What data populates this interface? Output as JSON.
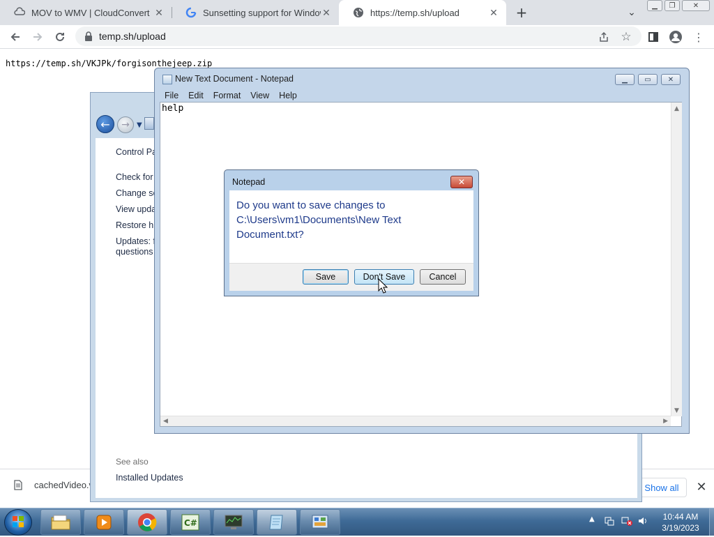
{
  "browser": {
    "tabs": [
      {
        "title": "MOV to WMV | CloudConvert",
        "icon": "cloudconvert-icon",
        "active": false
      },
      {
        "title": "Sunsetting support for Windows",
        "icon": "google-icon",
        "active": false
      },
      {
        "title": "https://temp.sh/upload",
        "icon": "globe-icon",
        "active": true
      }
    ],
    "new_tab_label": "+",
    "tab_search_label": "⌄",
    "address": "temp.sh/upload",
    "page_text": "https://temp.sh/VKJPk/forgisonthejeep.zip",
    "download": {
      "filename": "cachedVideo.v",
      "show_all_label": "Show all",
      "close_label": "✕"
    }
  },
  "control_panel": {
    "header_link": "Control Pa",
    "links": [
      "Check for",
      "Change se",
      "View upda",
      "Restore hid",
      "Updates: fr",
      "questions"
    ],
    "see_also_label": "See also",
    "see_also_links": [
      "Installed Updates"
    ]
  },
  "notepad": {
    "title": "New Text Document - Notepad",
    "menu": [
      "File",
      "Edit",
      "Format",
      "View",
      "Help"
    ],
    "content": "help"
  },
  "dialog": {
    "title": "Notepad",
    "message_line1": "Do you want to save changes to",
    "message_line2": "C:\\Users\\vm1\\Documents\\New Text",
    "message_line3": "Document.txt?",
    "buttons": {
      "save": "Save",
      "dont_save": "Don't Save",
      "cancel": "Cancel"
    },
    "close_label": "✕"
  },
  "taskbar": {
    "items": [
      "explorer",
      "media-player",
      "chrome",
      "csharp-editor",
      "task-manager",
      "notepad",
      "control-panel"
    ],
    "clock_time": "10:44 AM",
    "clock_date": "3/19/2023"
  },
  "colors": {
    "dialog_message": "#1e3a8a",
    "download_link": "#1a73e8"
  }
}
